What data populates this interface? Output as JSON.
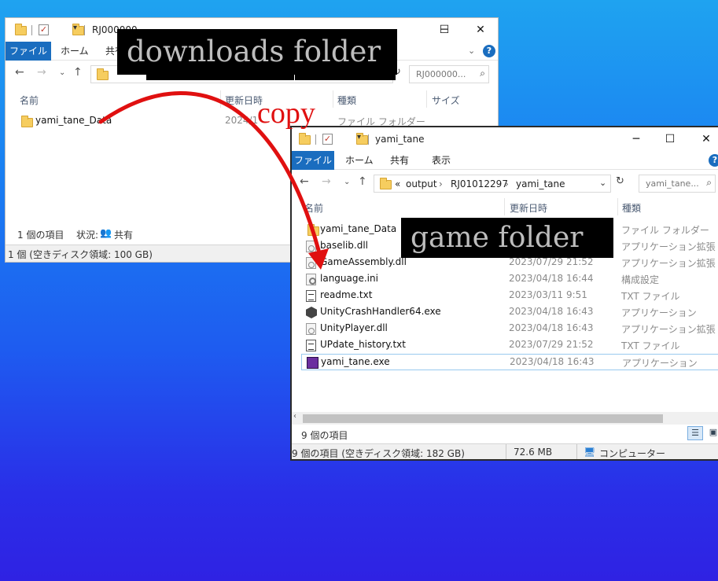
{
  "downloads_window": {
    "title": "RJ000000",
    "ribbon": {
      "file": "ファイル",
      "home": "ホーム",
      "share": "共有"
    },
    "search_placeholder": "RJ000000...",
    "columns": {
      "name": "名前",
      "date": "更新日時",
      "type": "種類",
      "size": "サイズ"
    },
    "item": {
      "name": "yami_tane_Data",
      "date": "2024/1",
      "type": "ファイル フォルダー"
    },
    "status": {
      "count": "1 個の項目",
      "state": "状況:",
      "shared": "共有"
    },
    "bottom": "1 個 (空きディスク領域: 100 GB)"
  },
  "game_window": {
    "title": "yami_tane",
    "ribbon": {
      "file": "ファイル",
      "home": "ホーム",
      "share": "共有",
      "view": "表示"
    },
    "address": {
      "prefix": "«",
      "parts": [
        "output",
        "RJ01012297",
        "yami_tane"
      ]
    },
    "search_placeholder": "yami_tane...",
    "columns": {
      "name": "名前",
      "date": "更新日時",
      "type": "種類"
    },
    "files": [
      {
        "name": "yami_tane_Data",
        "date": "",
        "type": "ファイル フォルダー",
        "icon": "folder-icon"
      },
      {
        "name": "baselib.dll",
        "date": "",
        "type": "アプリケーション拡張",
        "icon": "dll-icon"
      },
      {
        "name": "GameAssembly.dll",
        "date": "2023/07/29 21:52",
        "type": "アプリケーション拡張",
        "icon": "dll-icon"
      },
      {
        "name": "language.ini",
        "date": "2023/04/18 16:44",
        "type": "構成設定",
        "icon": "ini-icon"
      },
      {
        "name": "readme.txt",
        "date": "2023/03/11 9:51",
        "type": "TXT ファイル",
        "icon": "txt-icon"
      },
      {
        "name": "UnityCrashHandler64.exe",
        "date": "2023/04/18 16:43",
        "type": "アプリケーション",
        "icon": "unity-crash-icon"
      },
      {
        "name": "UnityPlayer.dll",
        "date": "2023/04/18 16:43",
        "type": "アプリケーション拡張",
        "icon": "dll-icon"
      },
      {
        "name": "UPdate_history.txt",
        "date": "2023/07/29 21:52",
        "type": "TXT ファイル",
        "icon": "txt-icon"
      },
      {
        "name": "yami_tane.exe",
        "date": "2023/04/18 16:43",
        "type": "アプリケーション",
        "icon": "game-exe-icon"
      }
    ],
    "status_count": "9 個の項目",
    "bottom": {
      "free": "9 個の項目 (空きディスク領域: 182 GB)",
      "size": "72.6 MB",
      "location": "コンピューター"
    }
  },
  "annotations": {
    "downloads_label": "downloads folder",
    "copy_label": "copy",
    "game_label": "game folder",
    "arrow_color": "#e01010"
  }
}
